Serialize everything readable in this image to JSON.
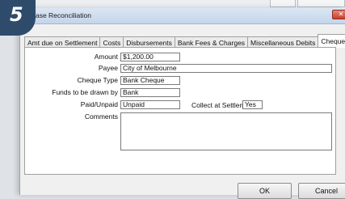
{
  "step_badge": "5",
  "window": {
    "title": "chase Reconciliation",
    "close_glyph": "✕"
  },
  "tabs": [
    {
      "label": "Amt due on Settlement",
      "active": false
    },
    {
      "label": "Costs",
      "active": false
    },
    {
      "label": "Disbursements",
      "active": false
    },
    {
      "label": "Bank Fees & Charges",
      "active": false
    },
    {
      "label": "Miscellaneous Debits",
      "active": false
    },
    {
      "label": "Cheques",
      "active": true
    }
  ],
  "form": {
    "amount_label": "Amount",
    "amount_value": "$1,200.00",
    "payee_label": "Payee",
    "payee_value": "City of Melbourne",
    "cheque_type_label": "Cheque Type",
    "cheque_type_value": "Bank Cheque",
    "funds_label": "Funds to be drawn by",
    "funds_value": "Bank",
    "paid_label": "Paid/Unpaid",
    "paid_value": "Unpaid",
    "collect_label": "Collect at Settlement?",
    "collect_value": "Yes",
    "comments_label": "Comments",
    "comments_value": ""
  },
  "buttons": {
    "ok": "OK",
    "cancel": "Cancel"
  }
}
